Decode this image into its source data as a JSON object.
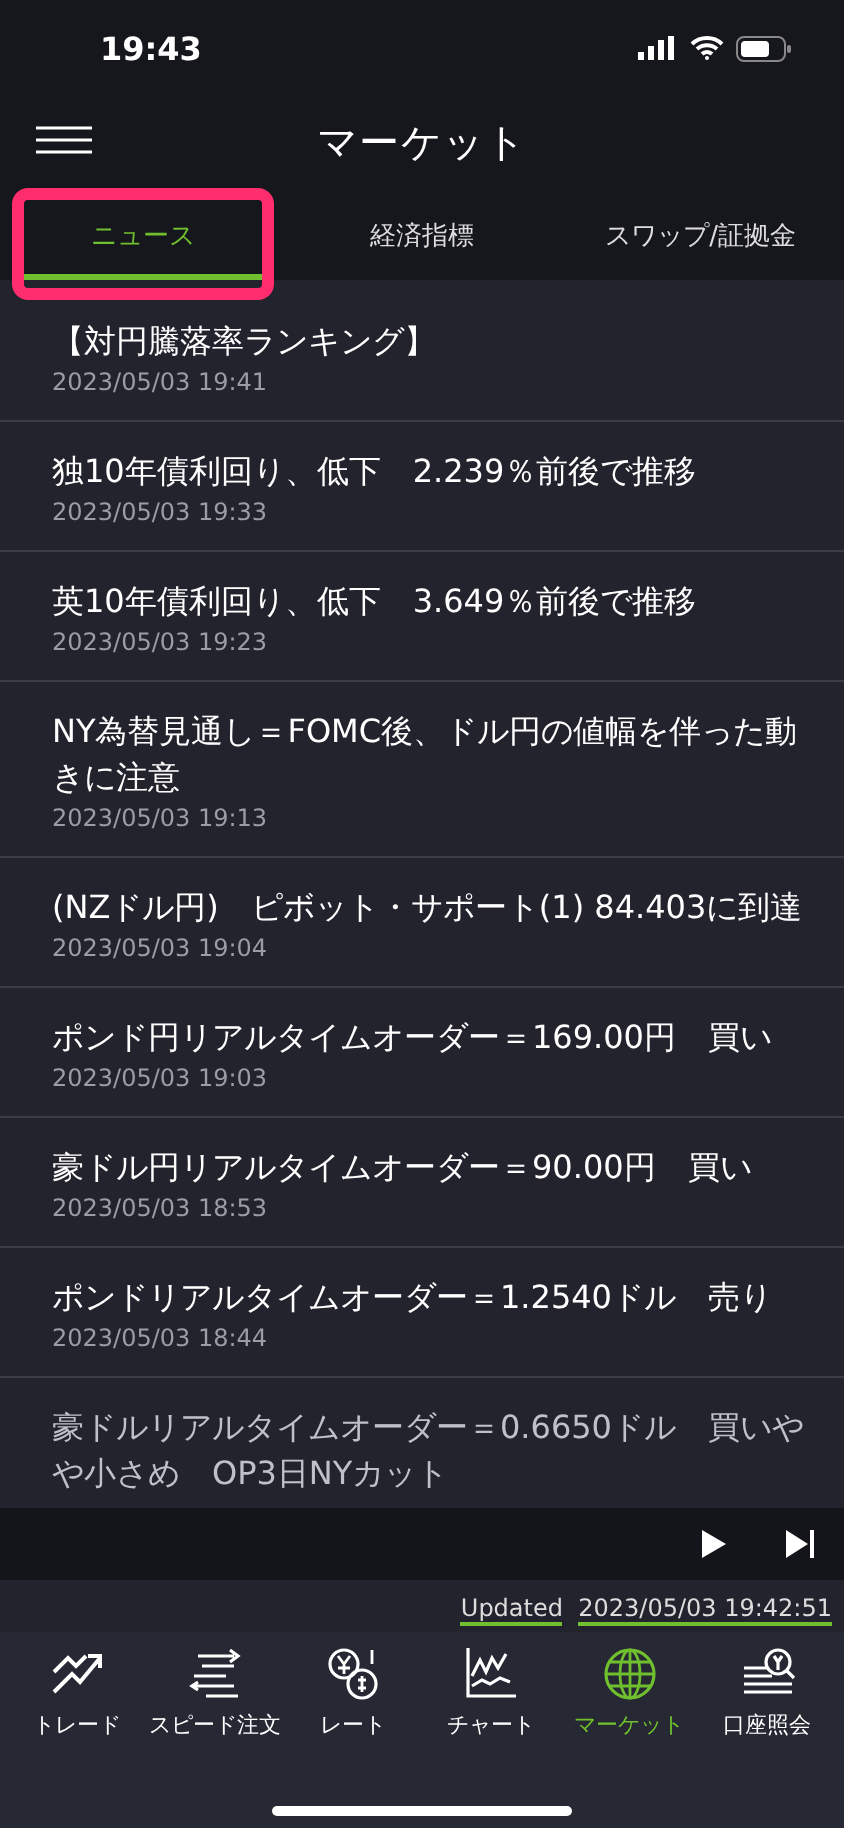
{
  "status_bar": {
    "time": "19:43"
  },
  "header": {
    "title": "マーケット"
  },
  "tabs": [
    {
      "label": "ニュース",
      "selected": true,
      "highlighted": true
    },
    {
      "label": "経済指標",
      "selected": false,
      "highlighted": false
    },
    {
      "label": "スワップ/証拠金",
      "selected": false,
      "highlighted": false
    }
  ],
  "news": [
    {
      "title": "【対円騰落率ランキング】",
      "date": "2023/05/03 19:41"
    },
    {
      "title": "独10年債利回り、低下　2.239％前後で推移",
      "date": "2023/05/03 19:33"
    },
    {
      "title": "英10年債利回り、低下　3.649％前後で推移",
      "date": "2023/05/03 19:23"
    },
    {
      "title": "NY為替見通し＝FOMC後、ドル円の値幅を伴った動きに注意",
      "date": "2023/05/03 19:13"
    },
    {
      "title": "(NZドル円)　ピボット・サポート(1) 84.403に到達",
      "date": "2023/05/03 19:04"
    },
    {
      "title": "ポンド円リアルタイムオーダー＝169.00円　買い",
      "date": "2023/05/03 19:03"
    },
    {
      "title": "豪ドル円リアルタイムオーダー＝90.00円　買い",
      "date": "2023/05/03 18:53"
    },
    {
      "title": "ポンドリアルタイムオーダー＝1.2540ドル　売り",
      "date": "2023/05/03 18:44"
    },
    {
      "title": "豪ドルリアルタイムオーダー＝0.6650ドル　買いやや小さめ　OP3日NYカット"
    }
  ],
  "ticker": {
    "label": "Updated",
    "time": "2023/05/03 19:42:51"
  },
  "nav": [
    {
      "kind": "trade",
      "label": "トレード",
      "selected": false
    },
    {
      "kind": "speed",
      "label": "スピード注文",
      "selected": false
    },
    {
      "kind": "rate",
      "label": "レート",
      "selected": false
    },
    {
      "kind": "chart",
      "label": "チャート",
      "selected": false
    },
    {
      "kind": "market",
      "label": "マーケット",
      "selected": true
    },
    {
      "kind": "account",
      "label": "口座照会",
      "selected": false
    }
  ]
}
